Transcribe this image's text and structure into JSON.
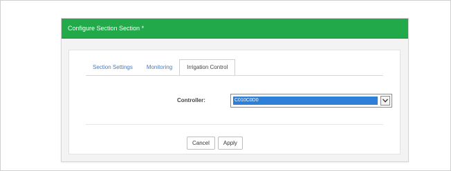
{
  "dialog": {
    "title": "Configure Section Section *"
  },
  "tabs": [
    {
      "label": "Section Settings",
      "active": false
    },
    {
      "label": "Monitoring",
      "active": false
    },
    {
      "label": "Irrigation Control",
      "active": true
    }
  ],
  "form": {
    "controller_label": "Controller:",
    "controller_value": "C010C0D0"
  },
  "buttons": {
    "cancel_label": "Cancel",
    "apply_label": "Apply"
  },
  "colors": {
    "titlebar": "#22a94a",
    "tab_link": "#4a78b8",
    "selection": "#2e7fd8"
  }
}
